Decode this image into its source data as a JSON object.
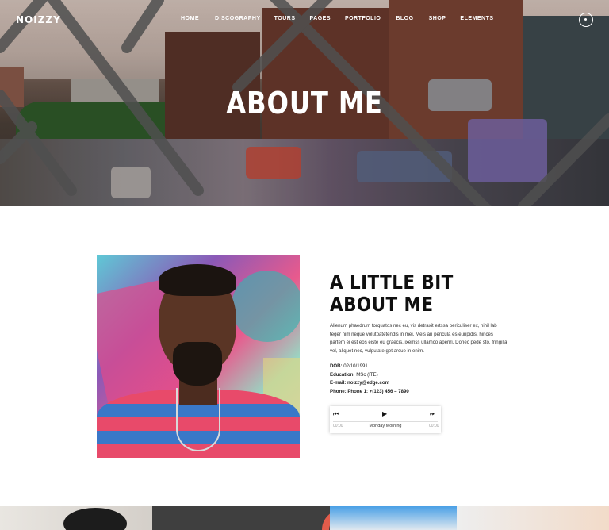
{
  "brand": {
    "logo": "NOIZZY"
  },
  "nav": {
    "items": [
      "HOME",
      "DISCOGRAPHY",
      "TOURS",
      "PAGES",
      "PORTFOLIO",
      "BLOG",
      "SHOP",
      "ELEMENTS"
    ]
  },
  "hero": {
    "title": "ABOUT ME"
  },
  "about": {
    "title_line1": "A LITTLE BIT",
    "title_line2": "ABOUT ME",
    "paragraph": "Alienum phaedrum torquatos nec eu, vis detraxit ertssa periculiser ex, nihil lab teger nim neque volutpatetendis in mei. Meis an pericula es euripidis, hinces partem ei est eos eiste eu graecis, ixemss ullamco aperiri. Donec pede sto, fringilla vel, aliquet nec, vulputate get arcue in enim.",
    "info": [
      {
        "label": "DOB:",
        "value": "02/10/1991"
      },
      {
        "label": "Education:",
        "value": "MSc (ITE)"
      },
      {
        "label": "E-mail:",
        "value": "noizzy@edge.com"
      },
      {
        "label": "Phone:",
        "value": "Phone 1: +(123) 456 – 7890"
      }
    ]
  },
  "player": {
    "song": "Monday Morning",
    "time_elapsed": "00:00",
    "time_total": "00:00",
    "icons": [
      "prev-icon",
      "play-icon",
      "next-icon"
    ]
  }
}
